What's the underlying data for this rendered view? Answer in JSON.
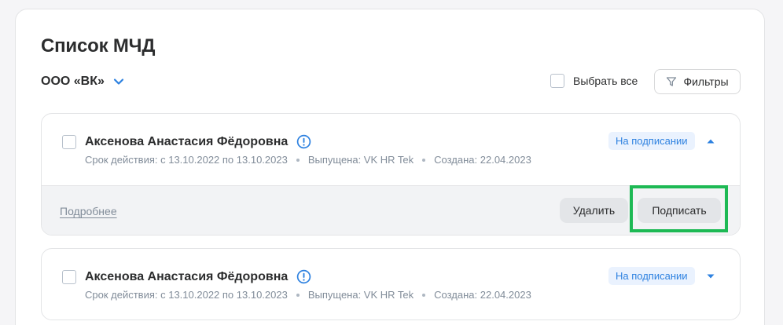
{
  "page": {
    "title": "Список МЧД",
    "org_name": "ООО «ВК»",
    "select_all_label": "Выбрать все",
    "filters_label": "Фильтры"
  },
  "cards": [
    {
      "name": "Аксенова Анастасия Фёдоровна",
      "validity": "Срок действия: с 13.10.2022 по 13.10.2023",
      "issuer": "Выпущена: VK HR Tek",
      "created": "Создана: 22.04.2023",
      "status": "На подписании",
      "expanded": true,
      "details_link": "Подробнее",
      "delete_label": "Удалить",
      "sign_label": "Подписать"
    },
    {
      "name": "Аксенова Анастасия Фёдоровна",
      "validity": "Срок действия: с 13.10.2022 по 13.10.2023",
      "issuer": "Выпущена: VK HR Tek",
      "created": "Создана: 22.04.2023",
      "status": "На подписании",
      "expanded": false
    }
  ],
  "colors": {
    "accent": "#2d81e0",
    "badge_bg": "#eaf2fe",
    "highlight": "#1db954",
    "muted_text": "#818c99"
  },
  "icons": {
    "org_dropdown": "chevron-down-icon",
    "filter": "filter-icon",
    "warning": "info-circle-icon",
    "expand": "caret-up-icon",
    "collapse": "caret-down-icon"
  }
}
